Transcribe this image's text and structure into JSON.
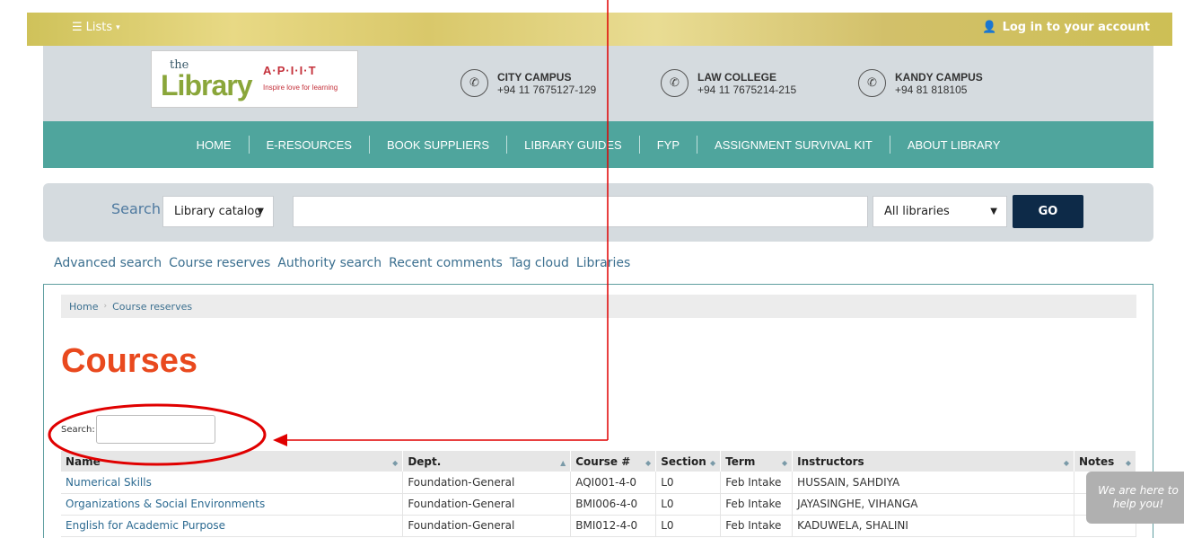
{
  "topbar": {
    "lists_label": "Lists",
    "login_label": "Log in to your account"
  },
  "logo": {
    "the": "the",
    "word": "Library",
    "apiit": "A·P·I·I·T",
    "tagline": "Inspire love for learning"
  },
  "contacts": [
    {
      "name": "CITY CAMPUS",
      "phone": "+94 11 7675127-129"
    },
    {
      "name": "LAW COLLEGE",
      "phone": "+94 11 7675214-215"
    },
    {
      "name": "KANDY CAMPUS",
      "phone": "+94 81 818105"
    }
  ],
  "nav": {
    "items": [
      "HOME",
      "E-RESOURCES",
      "BOOK SUPPLIERS",
      "LIBRARY GUIDES",
      "FYP",
      "ASSIGNMENT SURVIVAL KIT",
      "ABOUT LIBRARY"
    ]
  },
  "search": {
    "label": "Search",
    "scope": "Library catalog",
    "query": "",
    "branch": "All libraries",
    "go_label": "GO"
  },
  "more_searches": [
    "Advanced search",
    "Course reserves",
    "Authority search",
    "Recent comments",
    "Tag cloud",
    "Libraries"
  ],
  "breadcrumb": {
    "home": "Home",
    "current": "Course reserves"
  },
  "page_title": "Courses",
  "filter": {
    "label": "Search:",
    "value": ""
  },
  "table": {
    "headers": [
      "Name",
      "Dept.",
      "Course #",
      "Section",
      "Term",
      "Instructors",
      "Notes"
    ],
    "rows": [
      [
        "Numerical Skills",
        "Foundation-General",
        "AQI001-4-0",
        "L0",
        "Feb Intake",
        "HUSSAIN, SAHDIYA",
        ""
      ],
      [
        "Organizations & Social Environments",
        "Foundation-General",
        "BMI006-4-0",
        "L0",
        "Feb Intake",
        "JAYASINGHE, VIHANGA",
        ""
      ],
      [
        "English for Academic Purpose",
        "Foundation-General",
        "BMI012-4-0",
        "L0",
        "Feb Intake",
        "KADUWELA, SHALINI",
        ""
      ]
    ]
  },
  "chat": {
    "line1": "We are here to",
    "line2": "help you!"
  },
  "colors": {
    "nav": "#4fa59d",
    "title": "#e9491e",
    "go_button": "#0d2a48",
    "annotation": "#e00000"
  }
}
